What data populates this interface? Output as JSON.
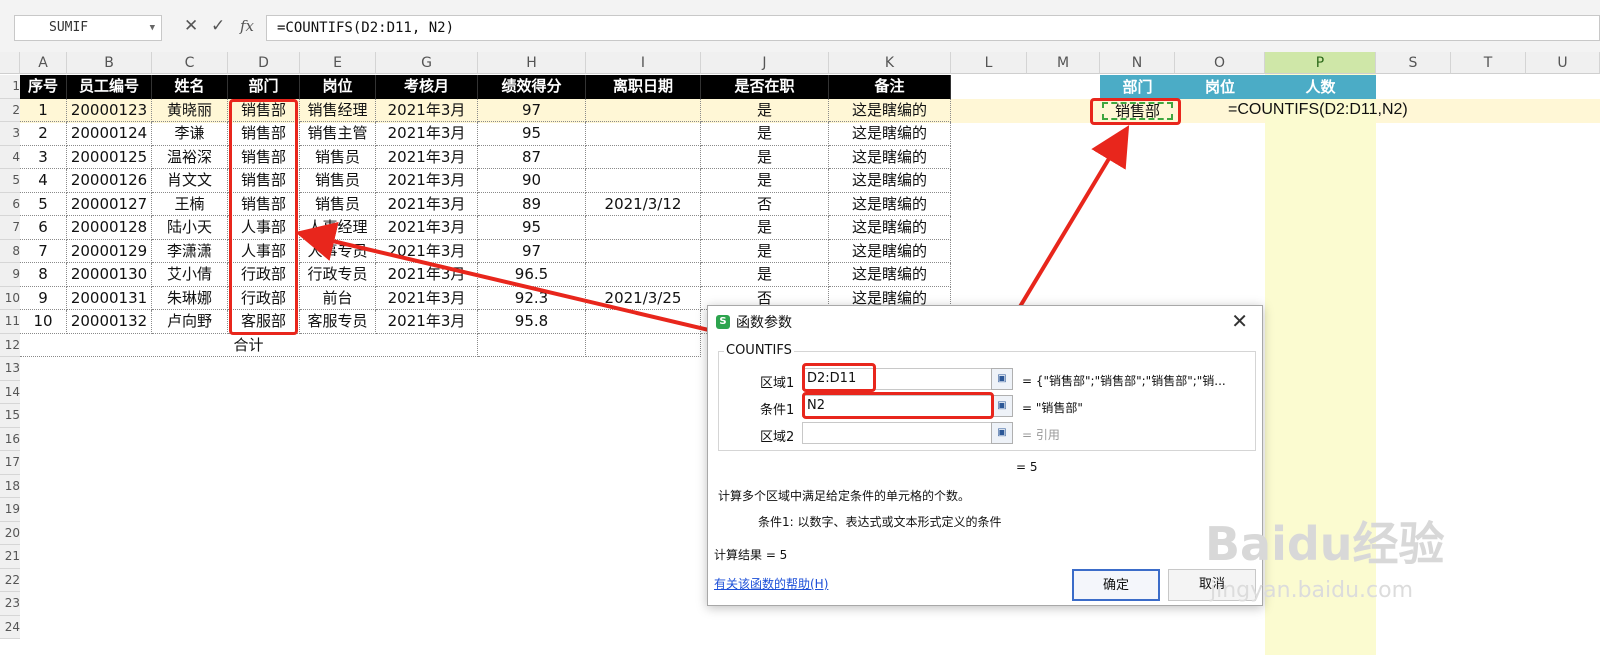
{
  "formula_bar": {
    "name_box": "SUMIF",
    "cancel_icon": "✕",
    "enter_icon": "✓",
    "fx_label": "fx",
    "formula": "=COUNTIFS(D2:D11, N2)"
  },
  "column_letters": [
    "A",
    "B",
    "C",
    "D",
    "E",
    "G",
    "H",
    "I",
    "J",
    "K",
    "L",
    "M",
    "N",
    "O",
    "P",
    "S",
    "T",
    "U"
  ],
  "row_numbers": [
    "1",
    "2",
    "3",
    "4",
    "5",
    "6",
    "7",
    "8",
    "9",
    "10",
    "11",
    "12",
    "13",
    "14",
    "15",
    "16",
    "17",
    "18",
    "19",
    "20",
    "21",
    "22",
    "23",
    "24"
  ],
  "table": {
    "headers": [
      "序号",
      "员工编号",
      "姓名",
      "部门",
      "岗位",
      "考核月",
      "绩效得分",
      "离职日期",
      "是否在职",
      "备注"
    ],
    "rows": [
      [
        "1",
        "20000123",
        "黄晓丽",
        "销售部",
        "销售经理",
        "2021年3月",
        "97",
        "",
        "是",
        "这是瞎编的"
      ],
      [
        "2",
        "20000124",
        "李谦",
        "销售部",
        "销售主管",
        "2021年3月",
        "95",
        "",
        "是",
        "这是瞎编的"
      ],
      [
        "3",
        "20000125",
        "温裕深",
        "销售部",
        "销售员",
        "2021年3月",
        "87",
        "",
        "是",
        "这是瞎编的"
      ],
      [
        "4",
        "20000126",
        "肖文文",
        "销售部",
        "销售员",
        "2021年3月",
        "90",
        "",
        "是",
        "这是瞎编的"
      ],
      [
        "5",
        "20000127",
        "王楠",
        "销售部",
        "销售员",
        "2021年3月",
        "89",
        "2021/3/12",
        "否",
        "这是瞎编的"
      ],
      [
        "6",
        "20000128",
        "陆小天",
        "人事部",
        "人事经理",
        "2021年3月",
        "95",
        "",
        "是",
        "这是瞎编的"
      ],
      [
        "7",
        "20000129",
        "李潇潇",
        "人事部",
        "人事专员",
        "2021年3月",
        "97",
        "",
        "是",
        "这是瞎编的"
      ],
      [
        "8",
        "20000130",
        "艾小倩",
        "行政部",
        "行政专员",
        "2021年3月",
        "96.5",
        "",
        "是",
        "这是瞎编的"
      ],
      [
        "9",
        "20000131",
        "朱琳娜",
        "行政部",
        "前台",
        "2021年3月",
        "92.3",
        "2021/3/25",
        "否",
        "这是瞎编的"
      ],
      [
        "10",
        "20000132",
        "卢向野",
        "客服部",
        "客服专员",
        "2021年3月",
        "95.8",
        "",
        "",
        ""
      ]
    ],
    "total_label": "合计"
  },
  "side_table": {
    "headers": [
      "部门",
      "岗位",
      "人数"
    ],
    "n2_value": "销售部",
    "p2_formula": "=COUNTIFS(D2:D11,N2)"
  },
  "dialog": {
    "title": "函数参数",
    "close_icon": "✕",
    "function_name": "COUNTIFS",
    "fields": [
      {
        "label": "区域1",
        "value": "D2:D11",
        "result": "= {\"销售部\";\"销售部\";\"销售部\";\"销..."
      },
      {
        "label": "条件1",
        "value": "N2",
        "result": "= \"销售部\""
      },
      {
        "label": "区域2",
        "value": "",
        "result": "= 引用"
      }
    ],
    "preview_result": "= 5",
    "description": "计算多个区域中满足给定条件的单元格的个数。",
    "param_description": "条件1:  以数字、表达式或文本形式定义的条件",
    "calc_result": "计算结果 = 5",
    "help_link": "有关该函数的帮助(H)",
    "ok_label": "确定",
    "cancel_label": "取消"
  },
  "watermark": {
    "brand": "Baidu经验",
    "url": "jingyan.baidu.com"
  },
  "colors": {
    "accent_red": "#e8261c",
    "header_black": "#000000",
    "side_header": "#4bacc6",
    "highlight_col": "#fbfbd0"
  }
}
